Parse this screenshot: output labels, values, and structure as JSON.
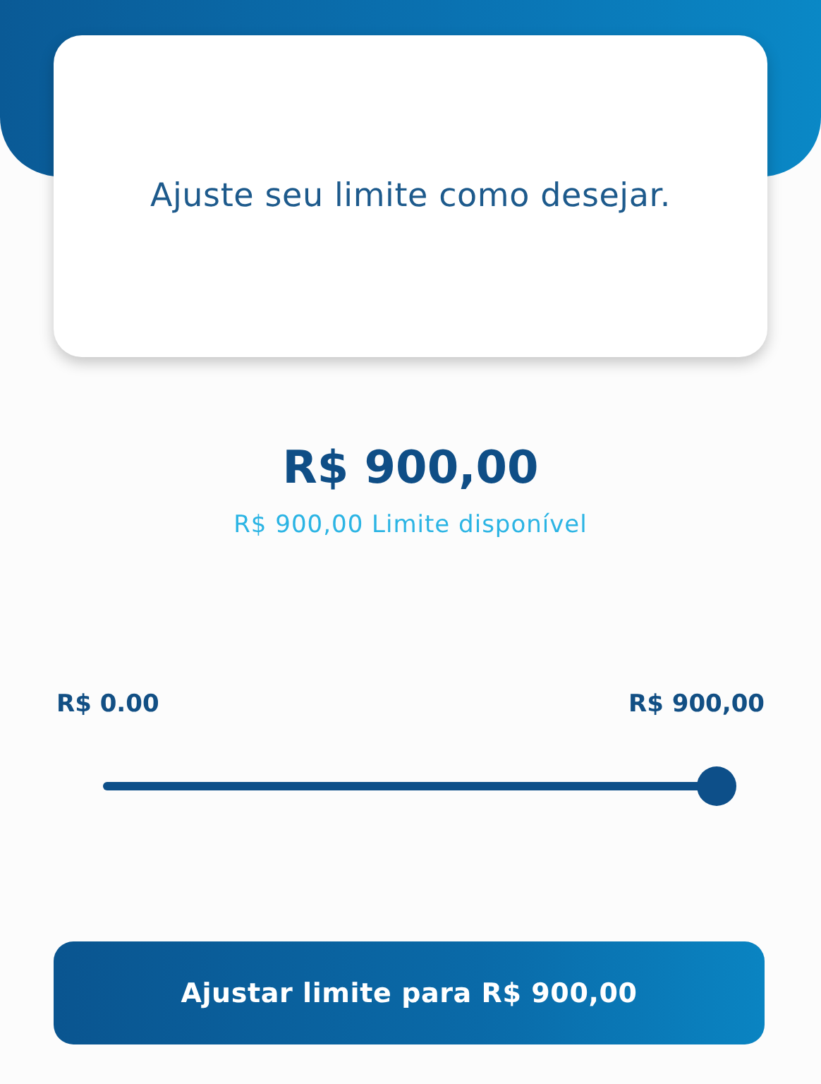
{
  "card": {
    "message": "Ajuste seu limite como desejar."
  },
  "amount": {
    "value": "R$ 900,00",
    "available": "R$ 900,00 Limite disponível"
  },
  "slider": {
    "min_label": "R$ 0.00",
    "max_label": "R$ 900,00",
    "level": 1
  },
  "button": {
    "label": "Ajustar limite para R$ 900,00"
  }
}
